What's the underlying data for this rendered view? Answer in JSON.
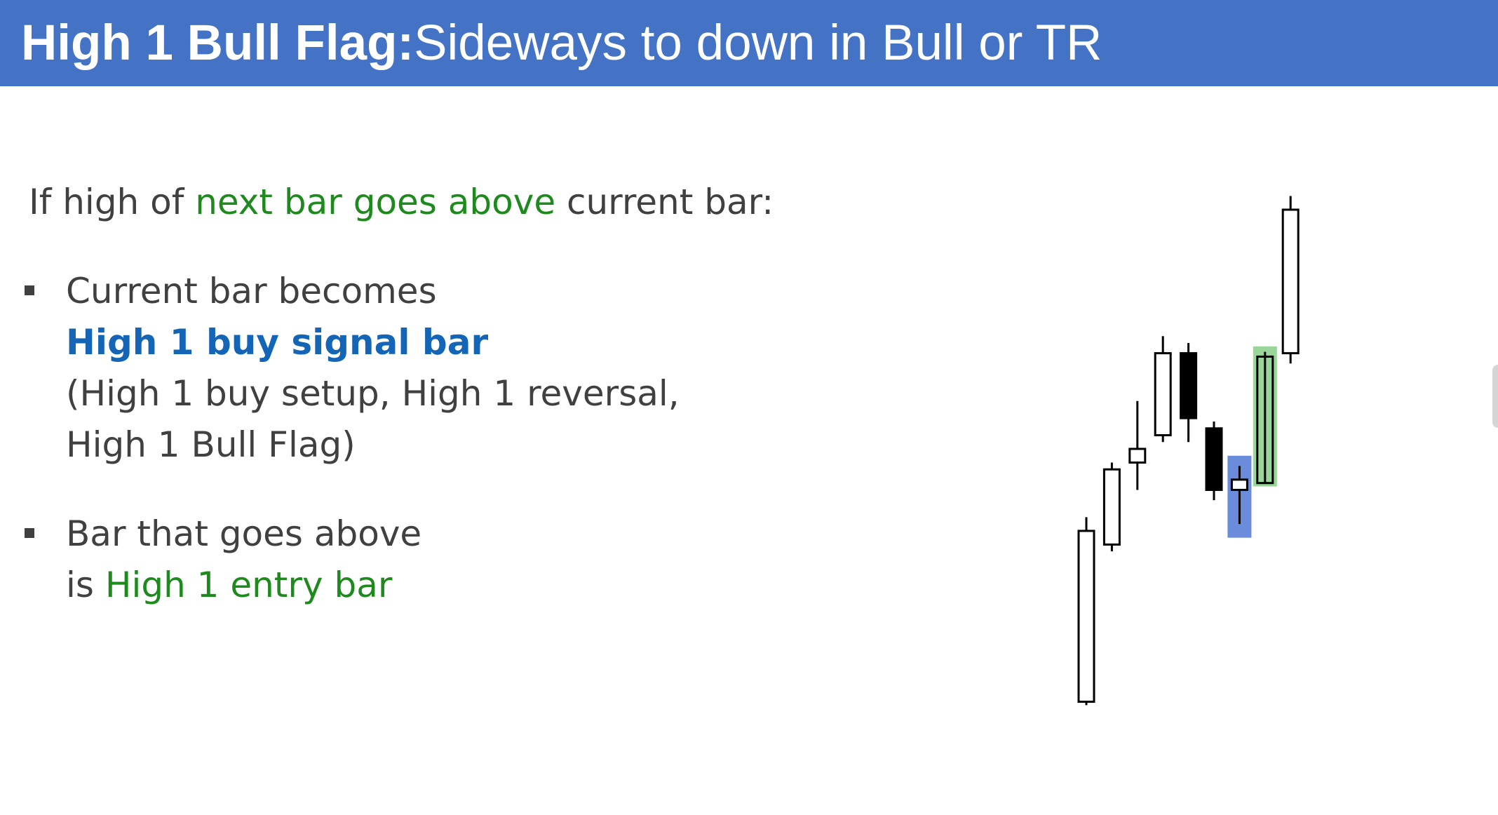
{
  "title": {
    "bold": "High 1 Bull Flag:",
    "rest": " Sideways to down in Bull or TR"
  },
  "intro": {
    "before": "If high of ",
    "highlight": "next bar goes above",
    "after": " current bar:"
  },
  "bullets": [
    {
      "line1": "Current bar becomes",
      "line2": "High 1 buy signal bar",
      "line3": "(High 1 buy setup, High 1 reversal,",
      "line4": "High 1 Bull Flag)"
    },
    {
      "line1": "Bar that goes above",
      "line2_prefix": "is ",
      "line2_highlight": "High 1 entry bar"
    }
  ],
  "colors": {
    "title_bg": "#4472c4",
    "text": "#404040",
    "green_text": "#1e8a1e",
    "blue_text": "#1565b6",
    "signal_bar_highlight": "#5b7fd6",
    "entry_bar_highlight": "#8fd18f"
  },
  "chart_data": {
    "type": "candlestick",
    "bars": [
      {
        "open": 20,
        "close": 270,
        "high": 290,
        "low": 15,
        "bull": true
      },
      {
        "open": 250,
        "close": 360,
        "high": 370,
        "low": 240,
        "bull": true
      },
      {
        "open": 370,
        "close": 390,
        "high": 460,
        "low": 330,
        "bull": true
      },
      {
        "open": 410,
        "close": 530,
        "high": 555,
        "low": 400,
        "bull": true
      },
      {
        "open": 530,
        "close": 435,
        "high": 545,
        "low": 400,
        "bull": false
      },
      {
        "open": 420,
        "close": 330,
        "high": 430,
        "low": 315,
        "bull": false
      },
      {
        "open": 330,
        "close": 345,
        "high": 365,
        "low": 280,
        "bull": true,
        "highlight": "signal"
      },
      {
        "open": 340,
        "close": 525,
        "high": 532,
        "low": 340,
        "bull": true,
        "highlight": "entry"
      },
      {
        "open": 530,
        "close": 740,
        "high": 760,
        "low": 515,
        "bull": true
      }
    ],
    "ylim": [
      0,
      780
    ]
  }
}
